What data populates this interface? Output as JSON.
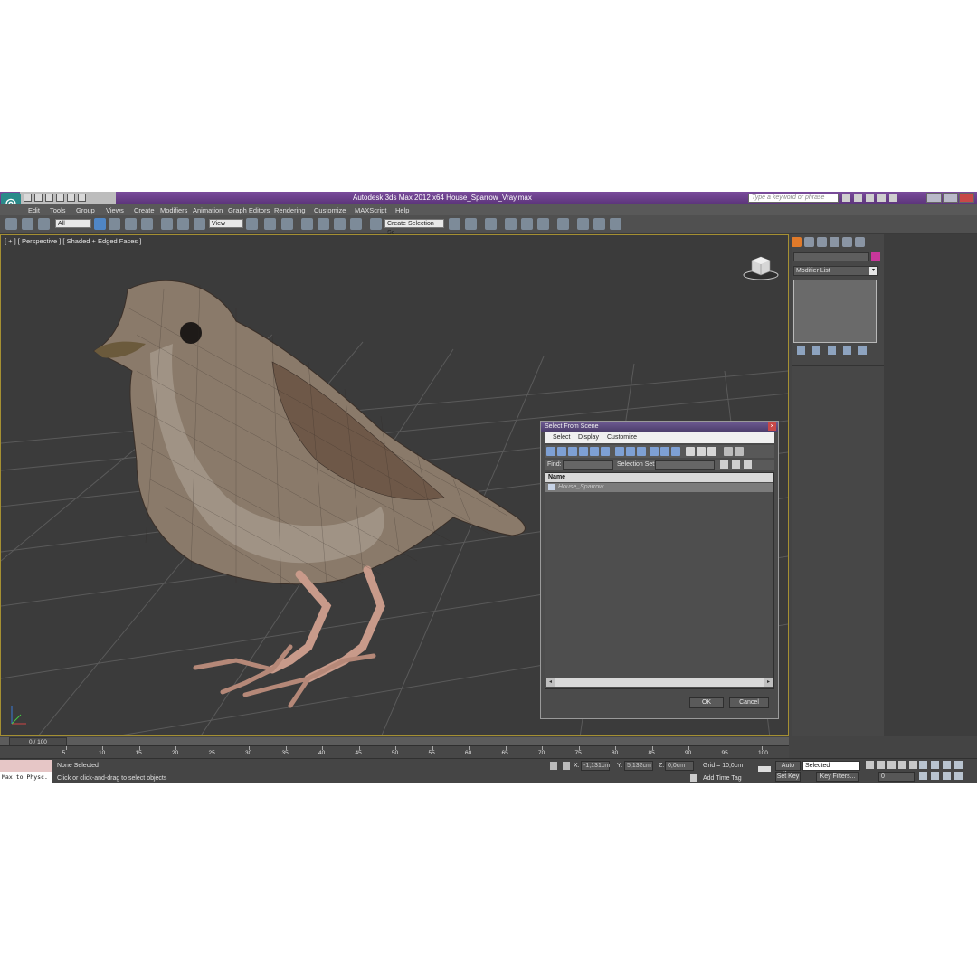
{
  "window": {
    "title": "Autodesk 3ds Max  2012 x64      House_Sparrow_Vray.max",
    "search_placeholder": "Type a keyword or phrase"
  },
  "menu": [
    "Edit",
    "Tools",
    "Group",
    "Views",
    "Create",
    "Modifiers",
    "Animation",
    "Graph Editors",
    "Rendering",
    "Customize",
    "MAXScript",
    "Help"
  ],
  "toolbar": {
    "selection_filter": "All",
    "reference_coord": "View",
    "named_selection": "Create Selection Se"
  },
  "viewport": {
    "label": "[ + ] [ Perspective ] [ Shaded + Edged Faces ]",
    "object": "house-sparrow-wireframe-model"
  },
  "command_panel": {
    "modifier_list": "Modifier List",
    "color_swatch": "#c8379a"
  },
  "dialog": {
    "title": "Select From Scene",
    "menu": [
      "Select",
      "Display",
      "Customize"
    ],
    "find_label": "Find:",
    "selection_set_label": "Selection Set:",
    "column_name": "Name",
    "rows": [
      "House_Sparrow"
    ],
    "ok": "OK",
    "cancel": "Cancel"
  },
  "timeline": {
    "frame": "0 / 100",
    "ticks": [
      "5",
      "10",
      "15",
      "20",
      "25",
      "30",
      "35",
      "40",
      "45",
      "50",
      "55",
      "60",
      "65",
      "70",
      "75",
      "80",
      "85",
      "90",
      "95",
      "100"
    ]
  },
  "status": {
    "maxscript": "Max to Physc.",
    "selection": "None Selected",
    "prompt": "Click or click-and-drag to select objects",
    "x_label": "X:",
    "x_value": "-1,131cm",
    "y_label": "Y:",
    "y_value": "5,132cm",
    "z_label": "Z:",
    "z_value": "0,0cm",
    "grid": "Grid = 10,0cm",
    "add_time_tag": "Add Time Tag",
    "auto_key": "Auto Key",
    "set_key": "Set Key",
    "key_mode": "Selected",
    "key_filters": "Key Filters...",
    "current_frame": "0"
  }
}
